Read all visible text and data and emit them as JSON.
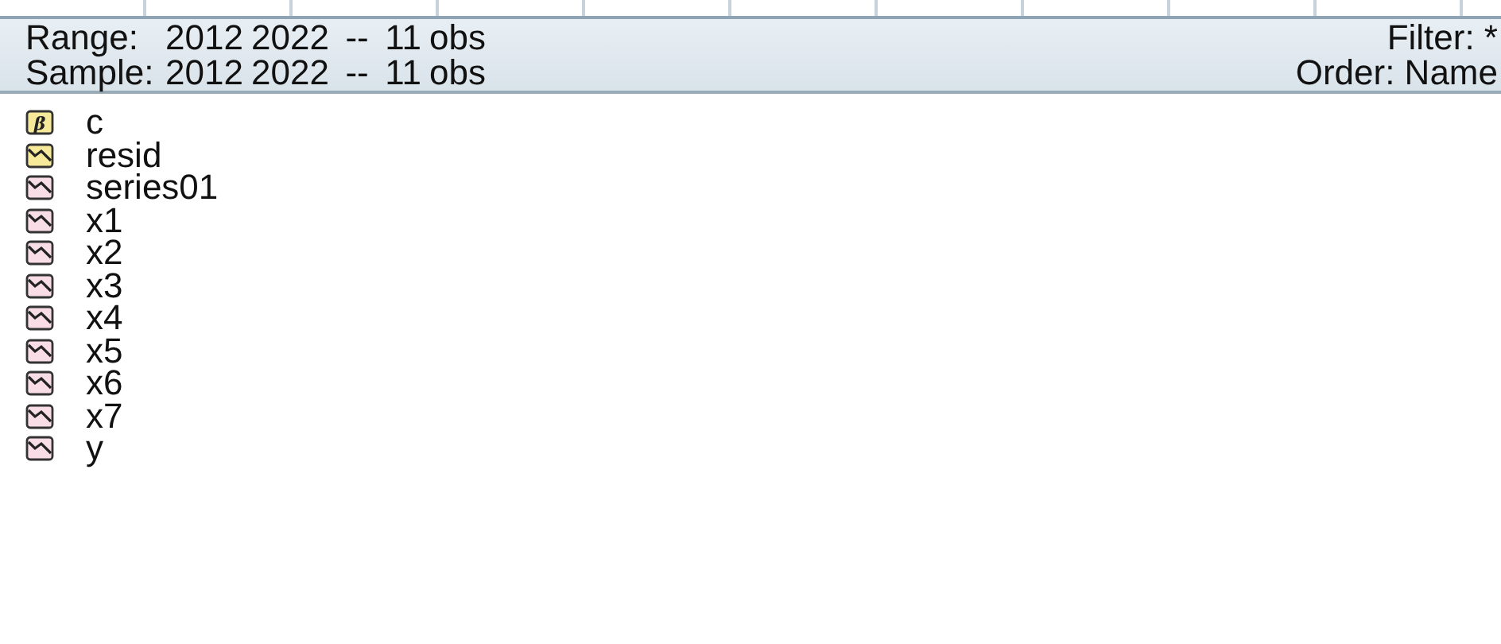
{
  "header": {
    "range": {
      "label": "Range:",
      "value": "2012 2022  --  11 obs"
    },
    "sample": {
      "label": "Sample:",
      "value": "2012 2022  --  11 obs"
    },
    "filter": "Filter: *",
    "order": "Order: Name"
  },
  "objects": [
    {
      "name": "c",
      "kind": "coefficient",
      "icon_label": "β"
    },
    {
      "name": "resid",
      "kind": "residual"
    },
    {
      "name": "series01",
      "kind": "series"
    },
    {
      "name": "x1",
      "kind": "series"
    },
    {
      "name": "x2",
      "kind": "series"
    },
    {
      "name": "x3",
      "kind": "series"
    },
    {
      "name": "x4",
      "kind": "series"
    },
    {
      "name": "x5",
      "kind": "series"
    },
    {
      "name": "x6",
      "kind": "series"
    },
    {
      "name": "x7",
      "kind": "series"
    },
    {
      "name": "y",
      "kind": "series"
    }
  ]
}
